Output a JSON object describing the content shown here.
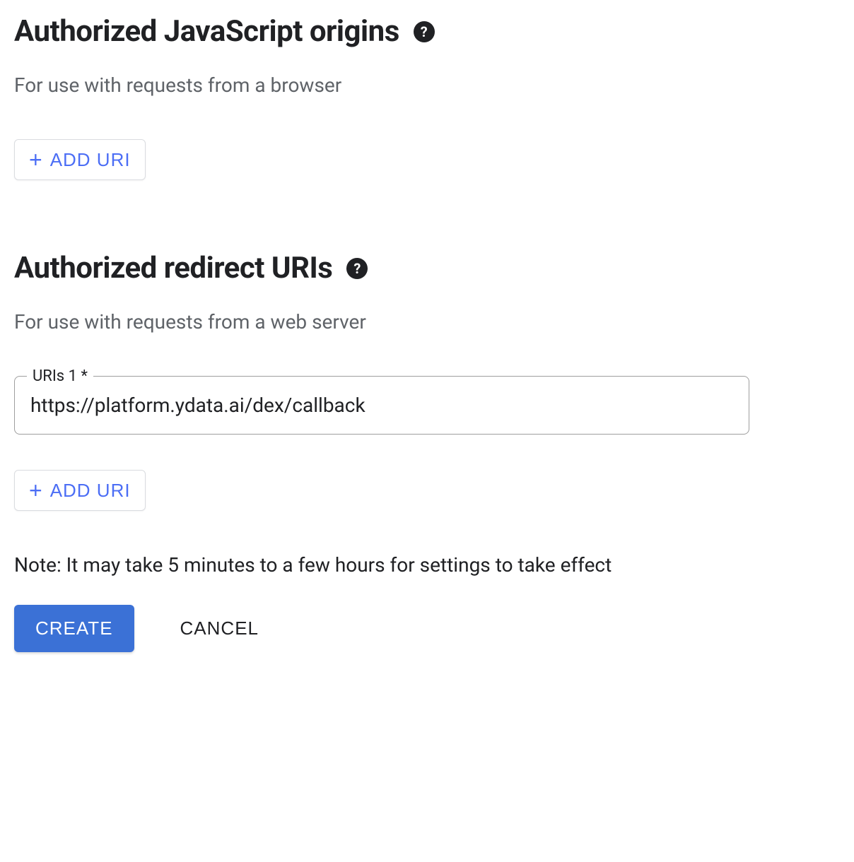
{
  "js_origins": {
    "title": "Authorized JavaScript origins",
    "description": "For use with requests from a browser",
    "add_uri_label": "ADD URI"
  },
  "redirect_uris": {
    "title": "Authorized redirect URIs",
    "description": "For use with requests from a web server",
    "field_label": "URIs 1 *",
    "field_value": "https://platform.ydata.ai/dex/callback",
    "add_uri_label": "ADD URI"
  },
  "note": "Note: It may take 5 minutes to a few hours for settings to take effect",
  "actions": {
    "create_label": "CREATE",
    "cancel_label": "CANCEL"
  },
  "help_icon_glyph": "?"
}
